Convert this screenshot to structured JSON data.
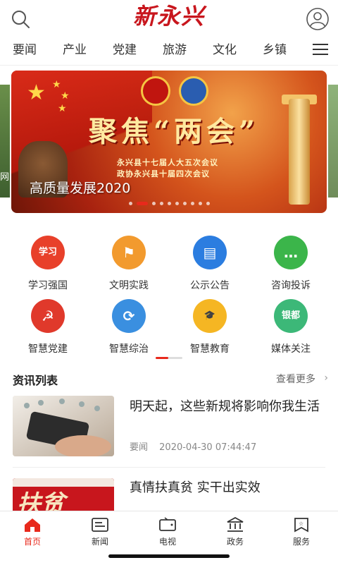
{
  "header": {
    "logo": "新永兴"
  },
  "categories": [
    "要闻",
    "产业",
    "党建",
    "旅游",
    "文化",
    "乡镇"
  ],
  "banner": {
    "title": "聚焦“两会”",
    "sub1": "永兴县十七届人大五次会议",
    "sub2": "政协永兴县十届四次会议",
    "caption": "高质量发展2020",
    "peek_text": "网",
    "slide_count": 10,
    "active_slide": 1
  },
  "grid": [
    {
      "label": "学习强国",
      "icon": "study-icon",
      "color": "#e8402a",
      "glyph": "学习"
    },
    {
      "label": "文明实践",
      "icon": "flag-icon",
      "color": "#f29a2e",
      "glyph": "⚑"
    },
    {
      "label": "公示公告",
      "icon": "notice-icon",
      "color": "#2b7de0",
      "glyph": "▤"
    },
    {
      "label": "咨询投诉",
      "icon": "chat-icon",
      "color": "#3bb54a",
      "glyph": "…"
    },
    {
      "label": "智慧党建",
      "icon": "party-flag-icon",
      "color": "#e0392b",
      "glyph": "☭"
    },
    {
      "label": "智慧综治",
      "icon": "recycle-icon",
      "color": "#3a8fe0",
      "glyph": "⟳"
    },
    {
      "label": "智慧教育",
      "icon": "graduation-cap-icon",
      "color": "#f5b623",
      "glyph": "🎓"
    },
    {
      "label": "媒体关注",
      "icon": "media-icon",
      "color": "#3cb878",
      "glyph": "银都"
    }
  ],
  "news_section": {
    "title": "资讯列表",
    "more": "查看更多"
  },
  "news": [
    {
      "title": "明天起，这些新规将影响你我生活",
      "category": "要闻",
      "time": "2020-04-30 07:44:47"
    },
    {
      "title": "真情扶真贫 实干出实效",
      "category": "",
      "time": ""
    }
  ],
  "tabs": [
    {
      "label": "首页",
      "icon": "home-icon",
      "active": true
    },
    {
      "label": "新闻",
      "icon": "news-icon",
      "active": false
    },
    {
      "label": "电视",
      "icon": "tv-icon",
      "active": false
    },
    {
      "label": "政务",
      "icon": "government-icon",
      "active": false
    },
    {
      "label": "服务",
      "icon": "service-icon",
      "active": false
    }
  ],
  "colors": {
    "accent": "#e8291c"
  }
}
